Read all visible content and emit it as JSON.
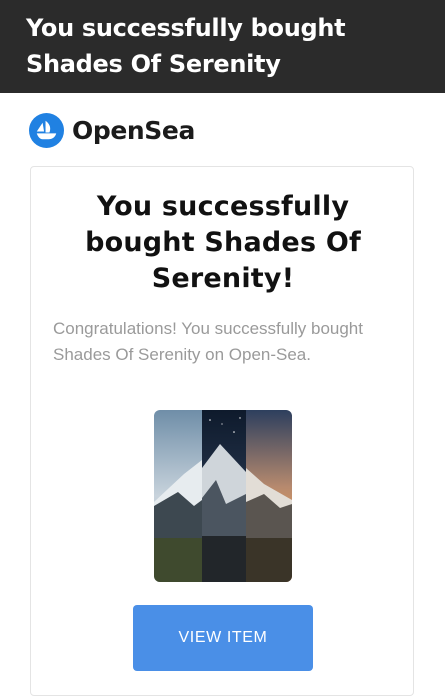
{
  "header": {
    "title": "You successfully bought Shades Of Serenity"
  },
  "brand": {
    "name": "OpenSea",
    "logo_icon": "opensea-logo-icon",
    "color": "#2081e2"
  },
  "card": {
    "heading": "You successfully bought Shades Of Serenity!",
    "message": "Congratulations! You successfully bought Shades Of Serenity on Open-Sea.",
    "image_icon": "mountain-triptych-image",
    "button_label": "VIEW ITEM",
    "button_color": "#4a8fe7"
  }
}
